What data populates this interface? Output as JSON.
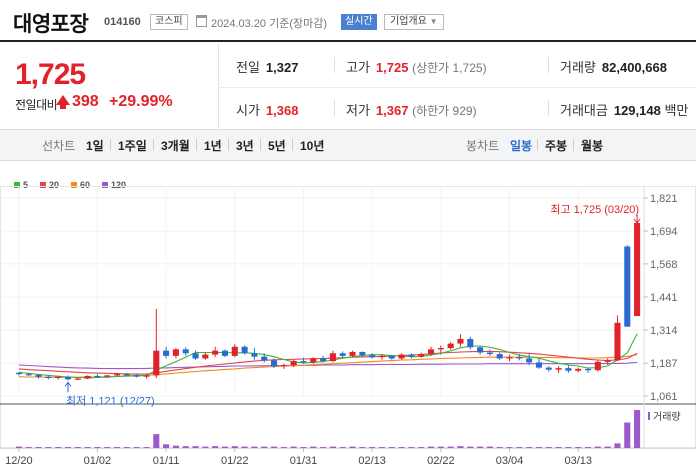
{
  "header": {
    "name": "대영포장",
    "code": "014160",
    "market": "코스피",
    "date": "2024.03.20",
    "date_suffix": "기준(장마감)",
    "realtime": "실시간",
    "company_info": "기업개요"
  },
  "quote": {
    "price": "1,725",
    "change_label": "전일대비",
    "change": "398",
    "change_pct": "+29.99%",
    "prev_close_label": "전일",
    "prev_close": "1,327",
    "high_label": "고가",
    "high": "1,725",
    "high_sub": "(상한가 1,725)",
    "volume_label": "거래량",
    "volume": "82,400,668",
    "open_label": "시가",
    "open": "1,368",
    "low_label": "저가",
    "low": "1,367",
    "low_sub": "(하한가 929)",
    "amount_label": "거래대금",
    "amount": "129,148",
    "amount_unit": "백만"
  },
  "tabs": {
    "line_label": "선차트",
    "periods": [
      "1일",
      "1주일",
      "3개월",
      "1년",
      "3년",
      "5년",
      "10년"
    ],
    "candle_label": "봉차트",
    "candles": [
      "일봉",
      "주봉",
      "월봉"
    ],
    "active_candle": "일봉"
  },
  "colors": {
    "up": "#e2222b",
    "down": "#2b6bd1",
    "ma5": "#3db83d",
    "ma20": "#e2444b",
    "ma60": "#f08a24",
    "ma120": "#9b59c9"
  },
  "chart_data": {
    "type": "candlestick",
    "legend": [
      {
        "name": "5",
        "color": "#3db83d"
      },
      {
        "name": "20",
        "color": "#e2444b"
      },
      {
        "name": "60",
        "color": "#f08a24"
      },
      {
        "name": "120",
        "color": "#9b59c9"
      }
    ],
    "y_ticks": [
      "1,821",
      "1,694",
      "1,568",
      "1,441",
      "1,314",
      "1,187",
      "1,061"
    ],
    "ylim": [
      1061,
      1821
    ],
    "x_ticks": [
      {
        "label": "12/20",
        "index": 0
      },
      {
        "label": "01/02",
        "index": 8
      },
      {
        "label": "01/11",
        "index": 15
      },
      {
        "label": "01/22",
        "index": 22
      },
      {
        "label": "01/31",
        "index": 29
      },
      {
        "label": "02/13",
        "index": 36
      },
      {
        "label": "02/22",
        "index": 43
      },
      {
        "label": "03/04",
        "index": 50
      },
      {
        "label": "03/13",
        "index": 57
      }
    ],
    "high_annotation": "최고 1,725 (03/20)",
    "low_annotation": "최저 1,121 (12/27)",
    "volume_label": "거래량",
    "candles": [
      [
        1150,
        1152,
        1140,
        1145
      ],
      [
        1145,
        1150,
        1138,
        1142
      ],
      [
        1142,
        1145,
        1128,
        1135
      ],
      [
        1135,
        1140,
        1125,
        1130
      ],
      [
        1130,
        1138,
        1124,
        1135
      ],
      [
        1135,
        1140,
        1121,
        1125
      ],
      [
        1125,
        1132,
        1122,
        1128
      ],
      [
        1128,
        1140,
        1126,
        1138
      ],
      [
        1138,
        1145,
        1130,
        1135
      ],
      [
        1135,
        1142,
        1130,
        1140
      ],
      [
        1140,
        1150,
        1135,
        1145
      ],
      [
        1145,
        1150,
        1136,
        1140
      ],
      [
        1140,
        1148,
        1132,
        1135
      ],
      [
        1135,
        1145,
        1128,
        1140
      ],
      [
        1140,
        1395,
        1130,
        1235
      ],
      [
        1235,
        1250,
        1205,
        1215
      ],
      [
        1215,
        1245,
        1205,
        1240
      ],
      [
        1240,
        1248,
        1215,
        1225
      ],
      [
        1225,
        1235,
        1200,
        1205
      ],
      [
        1205,
        1228,
        1200,
        1220
      ],
      [
        1220,
        1250,
        1210,
        1235
      ],
      [
        1235,
        1240,
        1210,
        1215
      ],
      [
        1215,
        1260,
        1210,
        1250
      ],
      [
        1250,
        1255,
        1220,
        1225
      ],
      [
        1225,
        1245,
        1200,
        1212
      ],
      [
        1212,
        1225,
        1190,
        1198
      ],
      [
        1198,
        1205,
        1168,
        1175
      ],
      [
        1175,
        1185,
        1165,
        1180
      ],
      [
        1180,
        1200,
        1172,
        1195
      ],
      [
        1195,
        1208,
        1185,
        1190
      ],
      [
        1190,
        1210,
        1185,
        1205
      ],
      [
        1205,
        1215,
        1190,
        1195
      ],
      [
        1195,
        1235,
        1190,
        1225
      ],
      [
        1225,
        1232,
        1208,
        1215
      ],
      [
        1215,
        1235,
        1210,
        1230
      ],
      [
        1230,
        1232,
        1212,
        1218
      ],
      [
        1218,
        1225,
        1205,
        1210
      ],
      [
        1210,
        1222,
        1200,
        1215
      ],
      [
        1215,
        1218,
        1200,
        1205
      ],
      [
        1205,
        1225,
        1200,
        1220
      ],
      [
        1220,
        1225,
        1205,
        1212
      ],
      [
        1212,
        1228,
        1208,
        1222
      ],
      [
        1222,
        1250,
        1215,
        1240
      ],
      [
        1240,
        1255,
        1220,
        1245
      ],
      [
        1245,
        1268,
        1238,
        1262
      ],
      [
        1262,
        1298,
        1250,
        1280
      ],
      [
        1280,
        1288,
        1240,
        1248
      ],
      [
        1248,
        1252,
        1220,
        1228
      ],
      [
        1228,
        1240,
        1215,
        1222
      ],
      [
        1222,
        1228,
        1200,
        1205
      ],
      [
        1205,
        1220,
        1195,
        1210
      ],
      [
        1210,
        1222,
        1198,
        1205
      ],
      [
        1205,
        1225,
        1180,
        1190
      ],
      [
        1190,
        1205,
        1165,
        1170
      ],
      [
        1170,
        1175,
        1155,
        1162
      ],
      [
        1162,
        1175,
        1150,
        1168
      ],
      [
        1168,
        1178,
        1150,
        1158
      ],
      [
        1158,
        1170,
        1152,
        1165
      ],
      [
        1165,
        1170,
        1150,
        1160
      ],
      [
        1160,
        1198,
        1155,
        1192
      ],
      [
        1192,
        1205,
        1180,
        1198
      ],
      [
        1198,
        1370,
        1195,
        1342
      ],
      [
        1635,
        1640,
        1327,
        1327
      ],
      [
        1368,
        1725,
        1367,
        1725
      ]
    ],
    "ma5": [
      1152,
      1148,
      1144,
      1140,
      1137,
      1134,
      1132,
      1131,
      1132,
      1133,
      1136,
      1138,
      1140,
      1140,
      1160,
      1177,
      1193,
      1210,
      1228,
      1228,
      1228,
      1228,
      1227,
      1227,
      1225,
      1220,
      1212,
      1201,
      1192,
      1188,
      1190,
      1193,
      1199,
      1206,
      1212,
      1216,
      1220,
      1219,
      1216,
      1214,
      1212,
      1213,
      1218,
      1225,
      1234,
      1246,
      1252,
      1253,
      1248,
      1240,
      1228,
      1218,
      1212,
      1206,
      1196,
      1187,
      1180,
      1176,
      1168,
      1170,
      1176,
      1200,
      1226,
      1300
    ],
    "ma20": [
      1165,
      1162,
      1160,
      1158,
      1156,
      1154,
      1152,
      1150,
      1149,
      1148,
      1147,
      1146,
      1145,
      1145,
      1150,
      1156,
      1161,
      1166,
      1171,
      1176,
      1180,
      1184,
      1188,
      1192,
      1195,
      1198,
      1200,
      1201,
      1202,
      1203,
      1204,
      1205,
      1206,
      1208,
      1210,
      1211,
      1212,
      1213,
      1214,
      1216,
      1218,
      1220,
      1223,
      1226,
      1228,
      1230,
      1231,
      1232,
      1232,
      1231,
      1229,
      1227,
      1225,
      1222,
      1218,
      1214,
      1210,
      1206,
      1202,
      1199,
      1197,
      1200,
      1205,
      1225
    ],
    "ma60": [
      1135,
      1134,
      1134,
      1133,
      1133,
      1133,
      1133,
      1134,
      1134,
      1135,
      1136,
      1137,
      1138,
      1140,
      1143,
      1146,
      1149,
      1152,
      1155,
      1158,
      1160,
      1163,
      1165,
      1168,
      1170,
      1172,
      1174,
      1176,
      1177,
      1179,
      1181,
      1183,
      1185,
      1187,
      1189,
      1191,
      1193,
      1195,
      1197,
      1199,
      1200,
      1202,
      1203,
      1205,
      1206,
      1207,
      1208,
      1209,
      1210,
      1210,
      1210,
      1210,
      1210,
      1209,
      1209,
      1208,
      1208,
      1207,
      1207,
      1207,
      1208,
      1210,
      1213,
      1220
    ],
    "ma120": [
      1180,
      1178,
      1176,
      1174,
      1172,
      1170,
      1169,
      1168,
      1167,
      1166,
      1166,
      1166,
      1166,
      1167,
      1168,
      1169,
      1170,
      1171,
      1172,
      1173,
      1174,
      1175,
      1176,
      1176,
      1177,
      1177,
      1178,
      1178,
      1179,
      1179,
      1179,
      1180,
      1180,
      1180,
      1181,
      1181,
      1181,
      1182,
      1182,
      1182,
      1182,
      1183,
      1183,
      1183,
      1184,
      1184,
      1184,
      1184,
      1185,
      1185,
      1185,
      1185,
      1185,
      1185,
      1185,
      1185,
      1185,
      1185,
      1185,
      1185,
      1186,
      1186,
      1187,
      1190
    ],
    "volume": [
      3,
      2,
      2,
      2,
      2,
      2,
      2,
      2,
      2,
      2,
      2,
      2,
      2,
      2,
      30,
      8,
      5,
      4,
      4,
      3,
      4,
      3,
      4,
      3,
      3,
      3,
      3,
      2,
      3,
      2,
      3,
      2,
      3,
      2,
      3,
      2,
      2,
      2,
      2,
      2,
      2,
      2,
      3,
      3,
      3,
      4,
      3,
      3,
      3,
      2,
      2,
      2,
      2,
      2,
      2,
      2,
      2,
      2,
      2,
      3,
      3,
      10,
      55,
      82
    ]
  }
}
